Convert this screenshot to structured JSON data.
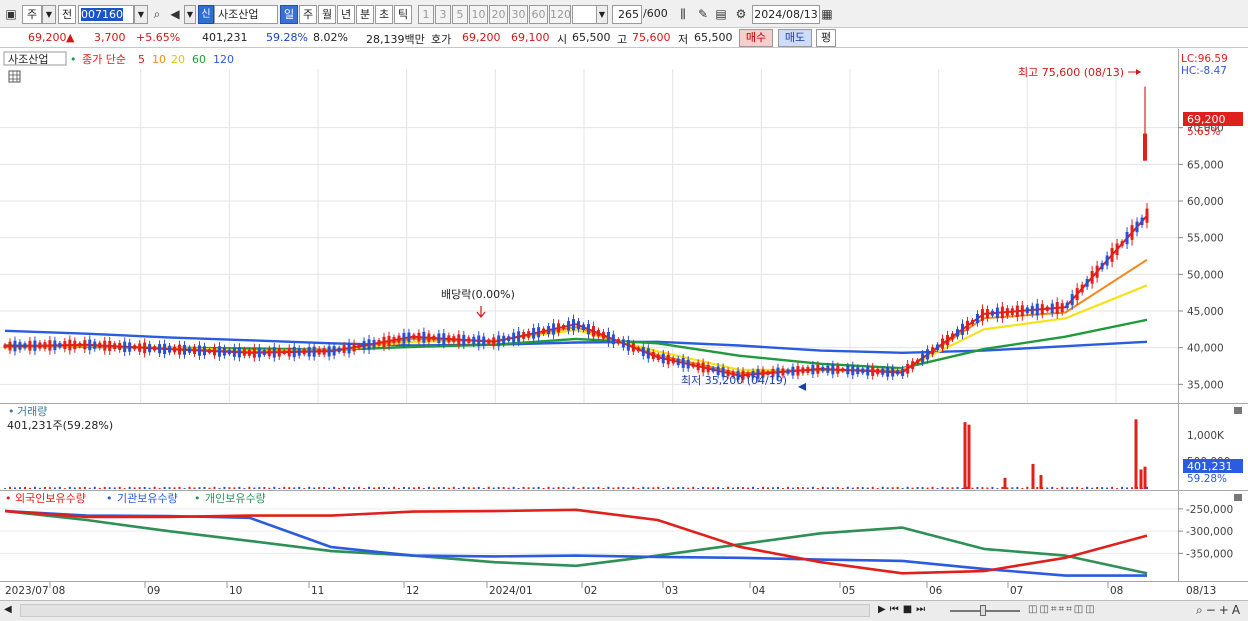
{
  "toolbar": {
    "market": "주",
    "prefix": "전",
    "code": "007160",
    "stock_badge": "신",
    "stock_name": "사조산업",
    "periods": [
      "일",
      "주",
      "월",
      "년",
      "분",
      "초",
      "틱"
    ],
    "active_period": "일",
    "intervals": [
      "1",
      "3",
      "5",
      "10",
      "20",
      "30",
      "60",
      "120"
    ],
    "count": "265",
    "count_total": "/600",
    "date": "2024/08/13"
  },
  "quote": {
    "price": "69,200",
    "change": "3,700",
    "change_pct": "+5.65%",
    "volume": "401,231",
    "volume_ratio": "59.28%",
    "turnover": "8.02%",
    "amount": "28,139백만",
    "ask_label": "호가",
    "ask": "69,200",
    "bid": "69,100",
    "open_label": "시",
    "open": "65,500",
    "high_label": "고",
    "high": "75,600",
    "low_label": "저",
    "low": "65,500",
    "buy": "매수",
    "sell": "매도",
    "eval": "평"
  },
  "price_panel": {
    "legend_name": "사조산업",
    "legend_ma_title": "종가 단순",
    "ma_periods": [
      "5",
      "10",
      "20",
      "60",
      "120"
    ],
    "lc_label": "LC:96.59",
    "hc_label": "HC:-8.47",
    "current_price_tag": "69,200",
    "current_pct_tag": "5.65%",
    "high_annotation": "최고 75,600 (08/13)",
    "low_annotation": "최저 35,200 (04/19)",
    "dividend_annotation": "배당락(0.00%)"
  },
  "volume_panel": {
    "title": "거래량",
    "info": "401,231주(59.28%)",
    "axis_label": "1,000K",
    "axis_label_hidden": "500,000",
    "current_tag": "401,231",
    "current_pct": "59.28%"
  },
  "holding_panel": {
    "legend_foreign": "외국인보유수량",
    "legend_inst": "기관보유수량",
    "legend_indiv": "개인보유수량"
  },
  "x_axis_labels": [
    "2023/07",
    "08",
    "09",
    "10",
    "11",
    "12",
    "2024/01",
    "02",
    "03",
    "04",
    "05",
    "06",
    "07",
    "08",
    "08/13"
  ],
  "colors": {
    "ma5": "#e0201a",
    "ma10": "#f08a1c",
    "ma20": "#f5e21a",
    "ma60": "#1f9a3c",
    "ma120": "#2a5be0",
    "up": "#e0201a",
    "down": "#2a4fd0",
    "foreign": "#e0201a",
    "inst": "#2a5be0",
    "indiv": "#2f8f57"
  },
  "chart_data": [
    {
      "type": "line",
      "title": "사조산업",
      "x": [
        "2023/07",
        "2023/08",
        "2023/09",
        "2023/10",
        "2023/11",
        "2023/12",
        "2024/01",
        "2024/02",
        "2024/03",
        "2024/04",
        "2024/05",
        "2024/06",
        "2024/07",
        "2024/08",
        "2024/08/13"
      ],
      "series": [
        {
          "name": "5",
          "values": [
            40200,
            40400,
            39800,
            39300,
            39500,
            41500,
            40800,
            43200,
            38700,
            36200,
            37100,
            36600,
            44600,
            45500,
            58000
          ]
        },
        {
          "name": "10",
          "values": [
            40100,
            40300,
            39900,
            39400,
            39600,
            41200,
            40900,
            42800,
            39000,
            36500,
            37000,
            36800,
            44000,
            44800,
            52000
          ]
        },
        {
          "name": "20",
          "values": [
            40000,
            40200,
            40000,
            39600,
            39600,
            40800,
            41000,
            42400,
            39500,
            37000,
            36900,
            37000,
            42500,
            44000,
            48500
          ]
        },
        {
          "name": "60",
          "values": [
            40300,
            40100,
            40000,
            39900,
            39700,
            40100,
            40400,
            41200,
            40600,
            38900,
            37800,
            37200,
            39800,
            41500,
            43800
          ]
        },
        {
          "name": "120",
          "values": [
            42300,
            41900,
            41400,
            41000,
            40600,
            40300,
            40400,
            40700,
            40800,
            40300,
            39600,
            39300,
            39600,
            40200,
            40800
          ]
        }
      ],
      "ylim": [
        33000,
        78000
      ],
      "y_ticks": [
        35000,
        40000,
        45000,
        50000,
        55000,
        60000,
        65000,
        70000
      ],
      "y_tick_labels": [
        "35,000",
        "40,000",
        "45,000",
        "50,000",
        "55,000",
        "60,000",
        "65,000",
        "70,000"
      ],
      "last": 69200,
      "high": 75600,
      "low": 35200
    },
    {
      "type": "bar",
      "title": "거래량",
      "categories": [
        "2023/07",
        "2023/08",
        "2023/09",
        "2023/10",
        "2023/11",
        "2023/12",
        "2024/01",
        "2024/02",
        "2024/03",
        "2024/04",
        "2024/05",
        "2024/06",
        "2024/06b",
        "2024/07",
        "2024/08",
        "2024/08/13"
      ],
      "values": [
        60000,
        55000,
        25000,
        20000,
        40000,
        30000,
        28000,
        45000,
        30000,
        25000,
        20000,
        35000,
        1200000,
        1050000,
        1250000,
        401231
      ],
      "ylim": [
        0,
        1400000
      ]
    },
    {
      "type": "line",
      "title": "보유수량",
      "x": [
        "2023/07",
        "2023/08",
        "2023/09",
        "2023/10",
        "2023/11",
        "2023/12",
        "2024/01",
        "2024/02",
        "2024/03",
        "2024/04",
        "2024/05",
        "2024/06",
        "2024/07",
        "2024/08",
        "2024/08/13"
      ],
      "series": [
        {
          "name": "외국인보유수량",
          "values": [
            -255000,
            -268000,
            -268000,
            -265000,
            -265000,
            -256000,
            -255000,
            -252000,
            -275000,
            -335000,
            -370000,
            -395000,
            -390000,
            -360000,
            -310000
          ]
        },
        {
          "name": "기관보유수량",
          "values": [
            -255000,
            -265000,
            -266000,
            -270000,
            -336000,
            -355000,
            -357000,
            -355000,
            -358000,
            -360000,
            -364000,
            -367000,
            -385000,
            -400000,
            -400000
          ]
        },
        {
          "name": "개인보유수량",
          "values": [
            -255000,
            -275000,
            -300000,
            -322000,
            -345000,
            -355000,
            -370000,
            -378000,
            -355000,
            -330000,
            -305000,
            -292000,
            -340000,
            -355000,
            -395000
          ]
        }
      ],
      "y_ticks": [
        -250000,
        -300000,
        -350000
      ],
      "y_tick_labels": [
        "-250,000",
        "-300,000",
        "-350,000"
      ],
      "ylim": [
        -410000,
        -230000
      ]
    }
  ]
}
